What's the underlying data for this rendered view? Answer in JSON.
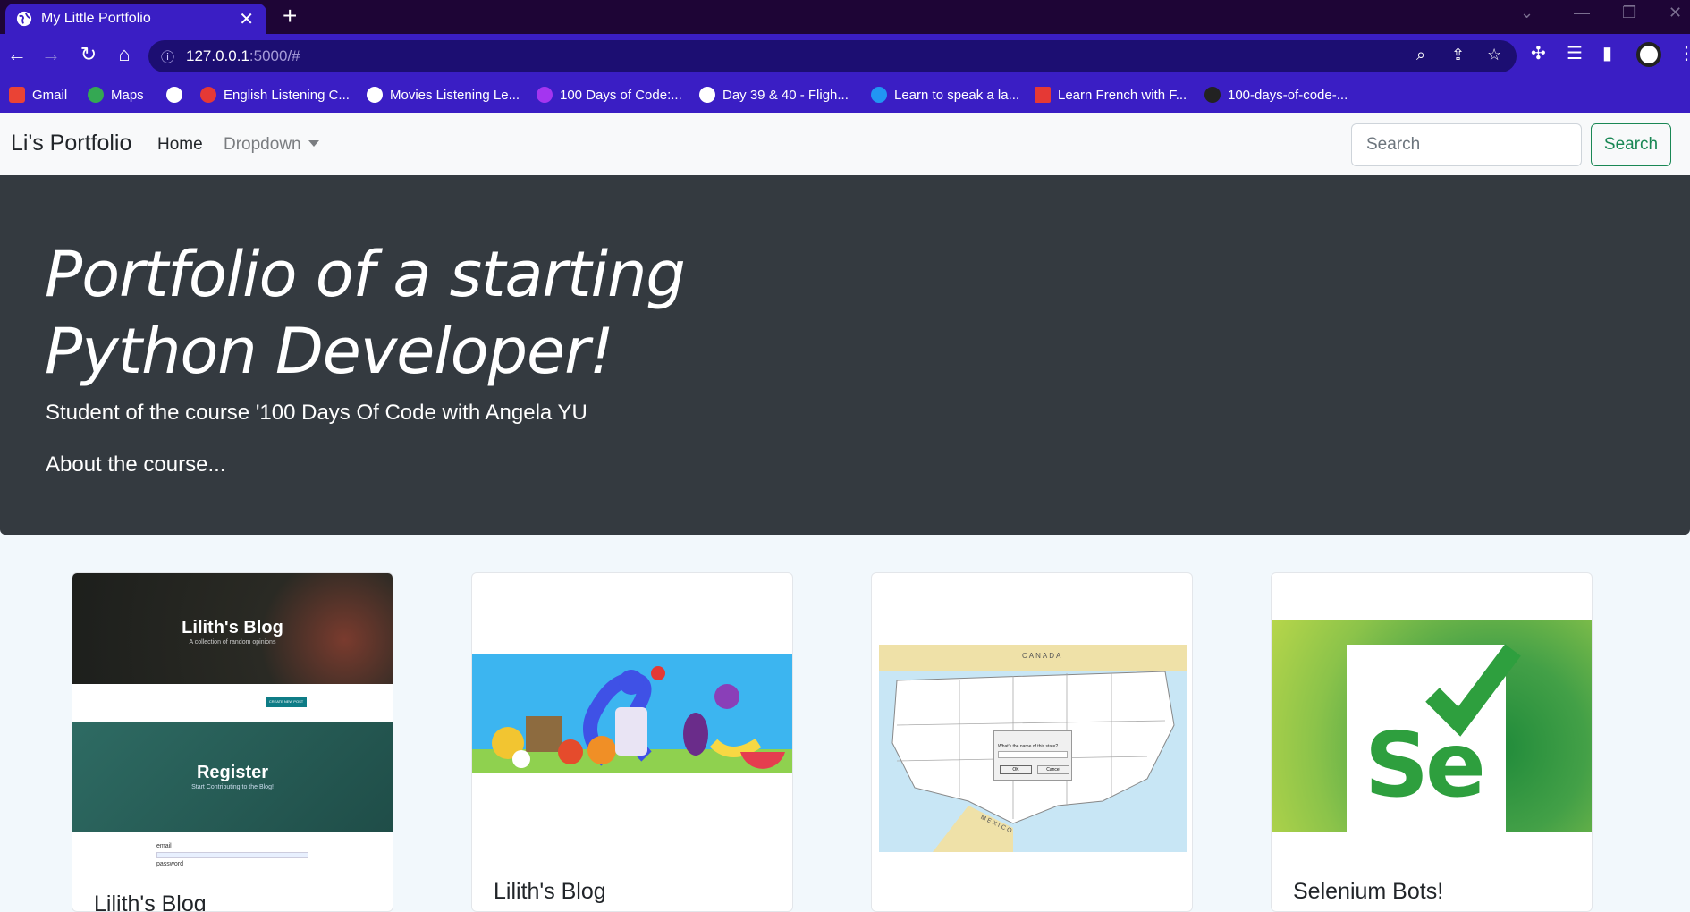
{
  "browser": {
    "tab_title": "My Little Portfolio",
    "url_host": "127.0.0.1",
    "url_rest": ":5000/#",
    "bookmarks": [
      {
        "label": "Gmail",
        "color": "#ea4335"
      },
      {
        "label": "Maps",
        "color": "#34a853"
      },
      {
        "label": "",
        "color": "#ffffff"
      },
      {
        "label": "English Listening C...",
        "color": "#e53935"
      },
      {
        "label": "Movies Listening Le...",
        "color": "#ffffff"
      },
      {
        "label": "100 Days of Code:...",
        "color": "#a435f0"
      },
      {
        "label": "Day 39 & 40 - Fligh...",
        "color": "#ffffff"
      },
      {
        "label": "Learn to speak a la...",
        "color": "#2196f3"
      },
      {
        "label": "Learn French with F...",
        "color": "#e53935"
      },
      {
        "label": "100-days-of-code-...",
        "color": "#222222"
      }
    ]
  },
  "navbar": {
    "brand": "Li's Portfolio",
    "home": "Home",
    "dropdown": "Dropdown",
    "search_placeholder": "Search",
    "search_button": "Search"
  },
  "hero": {
    "title": "Portfolio of a starting Python Developer!",
    "subtitle": "Student of the course '100 Days Of Code with Angela YU",
    "about": "About the course..."
  },
  "cards": [
    {
      "title": "Lilith's Blog",
      "thumb_top_heading": "Lilith's Blog",
      "thumb_top_sub": "A collection of random opinions",
      "thumb_bottom_heading": "Register",
      "thumb_bottom_sub": "Start Contributing to the Blog!",
      "thumb_field_email": "email",
      "thumb_field_password": "password",
      "thumb_button": "CREATE NEW POST"
    },
    {
      "title": "Lilith's Blog"
    },
    {
      "title": "",
      "map_label_top": "CANADA",
      "map_label_bottom": "MEXICO",
      "dialog_text": "What's the name of this state?",
      "dialog_ok": "OK",
      "dialog_cancel": "Cancel"
    },
    {
      "title": "Selenium Bots!",
      "logo_text": "Se"
    }
  ],
  "colors": {
    "tabbar": "#1e0536",
    "chrome": "#3a1ec4",
    "hero": "#343a40",
    "accent_green": "#198754"
  }
}
